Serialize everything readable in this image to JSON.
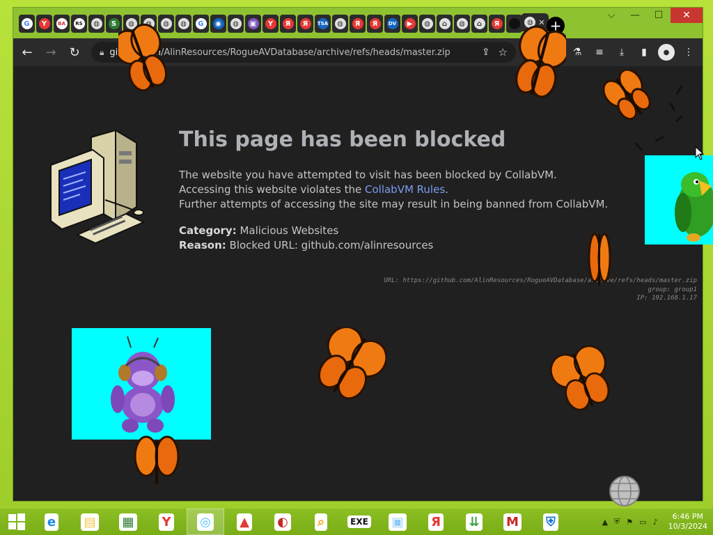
{
  "browser": {
    "tabs": [
      {
        "glyph": "G",
        "bg": "#ffffff",
        "fg": "#4285f4"
      },
      {
        "glyph": "Y",
        "bg": "#e53935",
        "fg": "#ffffff"
      },
      {
        "glyph": "BA",
        "bg": "#ffffff",
        "fg": "#d32f2f"
      },
      {
        "glyph": "RS",
        "bg": "#ffffff",
        "fg": "#111111"
      },
      {
        "glyph": "◍",
        "bg": "#e0e0e0",
        "fg": "#333333"
      },
      {
        "glyph": "S",
        "bg": "#2e7d32",
        "fg": "#ffffff"
      },
      {
        "glyph": "◍",
        "bg": "#e0e0e0",
        "fg": "#333333"
      },
      {
        "glyph": "◍",
        "bg": "#e0e0e0",
        "fg": "#333333"
      },
      {
        "glyph": "◍",
        "bg": "#e0e0e0",
        "fg": "#333333"
      },
      {
        "glyph": "◍",
        "bg": "#e0e0e0",
        "fg": "#333333"
      },
      {
        "glyph": "G",
        "bg": "#ffffff",
        "fg": "#4285f4"
      },
      {
        "glyph": "◉",
        "bg": "#1565c0",
        "fg": "#ffffff"
      },
      {
        "glyph": "◍",
        "bg": "#e0e0e0",
        "fg": "#333333"
      },
      {
        "glyph": "▣",
        "bg": "#7e57c2",
        "fg": "#ffffff"
      },
      {
        "glyph": "Y",
        "bg": "#e53935",
        "fg": "#ffffff"
      },
      {
        "glyph": "Я",
        "bg": "#e53935",
        "fg": "#ffffff"
      },
      {
        "glyph": "Я",
        "bg": "#e53935",
        "fg": "#ffffff"
      },
      {
        "glyph": "TSA",
        "bg": "#1565c0",
        "fg": "#ffffff"
      },
      {
        "glyph": "◍",
        "bg": "#e0e0e0",
        "fg": "#333333"
      },
      {
        "glyph": "Я",
        "bg": "#e53935",
        "fg": "#ffffff"
      },
      {
        "glyph": "Я",
        "bg": "#e53935",
        "fg": "#ffffff"
      },
      {
        "glyph": "DV",
        "bg": "#1565c0",
        "fg": "#ffffff"
      },
      {
        "glyph": "▶",
        "bg": "#e53935",
        "fg": "#ffffff"
      },
      {
        "glyph": "◍",
        "bg": "#e0e0e0",
        "fg": "#333333"
      },
      {
        "glyph": "⌂",
        "bg": "#e0e0e0",
        "fg": "#333333"
      },
      {
        "glyph": "◍",
        "bg": "#e0e0e0",
        "fg": "#333333"
      },
      {
        "glyph": "⌂",
        "bg": "#e0e0e0",
        "fg": "#333333"
      },
      {
        "glyph": "Я",
        "bg": "#e53935",
        "fg": "#ffffff"
      },
      {
        "glyph": "●",
        "bg": "#111111",
        "fg": "#111111"
      },
      {
        "glyph": "◍",
        "bg": "#e0e0e0",
        "fg": "#333333"
      }
    ],
    "active_tab_close": "✕",
    "new_tab": "+",
    "caption": {
      "collapse": "⌵",
      "minimize": "—",
      "maximize": "☐",
      "close": "✕"
    },
    "toolbar": {
      "back": "←",
      "forward": "→",
      "reload": "↻",
      "url_host": "github.com",
      "url_path": "/AlinResources/RogueAVDatabase/archive/refs/heads/master.zip",
      "share": "⇪",
      "star": "☆",
      "ext": "⚗",
      "media": "≡",
      "download": "⤓",
      "sidepanel": "▮",
      "profile": "●",
      "menu": "⋮"
    }
  },
  "page": {
    "title": "This page has been blocked",
    "msg1": "The website you have attempted to visit has been blocked by CollabVM.",
    "msg2_pre": "Accessing this website violates the ",
    "msg2_link": "CollabVM Rules",
    "msg2_post": ".",
    "msg3": "Further attempts of accessing the site may result in being banned from CollabVM.",
    "category_label": "Category:",
    "category_value": " Malicious Websites",
    "reason_label": "Reason:",
    "reason_value": " Blocked URL: github.com/alinresources",
    "tech_url": "URL: https://github.com/AlinResources/RogueAVDatabase/archive/refs/heads/master.zip",
    "tech_group": "group: group1",
    "tech_ip": "IP: 192.168.1.17"
  },
  "taskbar": {
    "apps": [
      {
        "icon": "ie-icon",
        "glyph": "e",
        "color": "#1e88e5"
      },
      {
        "icon": "explorer-icon",
        "glyph": "▤",
        "color": "#f4c542"
      },
      {
        "icon": "store-icon",
        "glyph": "▦",
        "color": "#2e7d32"
      },
      {
        "icon": "yandex-icon",
        "glyph": "Y",
        "color": "#e53935"
      },
      {
        "icon": "globe-app-icon",
        "glyph": "◎",
        "color": "#4fc3f7"
      },
      {
        "icon": "fox-app-icon",
        "glyph": "▲",
        "color": "#e53935"
      },
      {
        "icon": "red-swirl-icon",
        "glyph": "◐",
        "color": "#c62828"
      },
      {
        "icon": "magnifier-app-icon",
        "glyph": "⌕",
        "color": "#f9a825"
      },
      {
        "icon": "youtube-exe-icon",
        "glyph": "EXE",
        "color": "#111111"
      },
      {
        "icon": "window-app-icon",
        "glyph": "▣",
        "color": "#90caf9"
      },
      {
        "icon": "yandex-browser-icon",
        "glyph": "Я",
        "color": "#e53935"
      },
      {
        "icon": "download-manager-icon",
        "glyph": "⇊",
        "color": "#43a047"
      },
      {
        "icon": "mcafee-icon",
        "glyph": "M",
        "color": "#c62828"
      },
      {
        "icon": "shield-app-icon",
        "glyph": "⛨",
        "color": "#1976d2"
      }
    ],
    "time": "6:46 PM",
    "date": "10/3/2024"
  }
}
